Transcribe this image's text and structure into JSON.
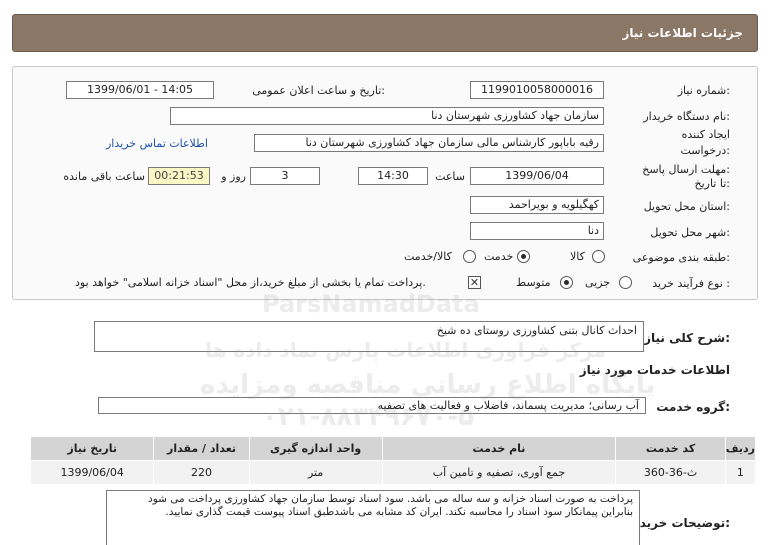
{
  "header": {
    "title": "جزئیات اطلاعات نیاز"
  },
  "form": {
    "need_number_label": "شماره نیاز:",
    "need_number": "1199010058000016",
    "announce_label": "تاریخ و ساعت اعلان عمومی:",
    "announce_value": "1399/06/01 - 14:05",
    "buyer_label": "نام دستگاه خریدار:",
    "buyer_value": "سازمان جهاد کشاورزی شهرستان دنا",
    "creator_label_1": "ایجاد کننده",
    "creator_label_2": "درخواست:",
    "creator_value": "رقیه باباپور کارشناس مالی سازمان جهاد کشاورزی شهرستان دنا",
    "contact_link": "اطلاعات تماس خریدار",
    "deadline_label_1": "مهلت ارسال پاسخ:",
    "deadline_label_2": "تا تاریخ:",
    "deadline_date": "1399/06/04",
    "time_label": "ساعت",
    "deadline_time": "14:30",
    "days_value": "3",
    "days_label": "روز و",
    "remaining_time": "00:21:53",
    "remaining_label": "ساعت باقی مانده",
    "province_label": "استان محل تحویل:",
    "province_value": "کهگیلویه و بویراحمد",
    "city_label": "شهر محل تحویل:",
    "city_value": "دنا",
    "category_label": "طبقه بندی موضوعی:",
    "category_options": [
      "کالا",
      "خدمت",
      "کالا/خدمت"
    ],
    "category_selected": "خدمت",
    "process_label": "نوع فرآیند خرید :",
    "process_options": [
      "جزیی",
      "متوسط"
    ],
    "process_selected": "متوسط",
    "payment_note": "پرداخت تمام یا بخشی از مبلغ خرید،از محل \"اسناد خزانه اسلامی\" خواهد بود."
  },
  "summary": {
    "label": "شرح کلی نیاز:",
    "value": "احداث کانال بتنی کشاورزی روستای ده شیخ"
  },
  "services": {
    "section_title": "اطلاعات خدمات مورد نیاز",
    "group_label": "گروه خدمت:",
    "group_value": "آب رسانی؛ مدیریت پسماند، فاضلاب و فعالیت های تصفیه",
    "columns": [
      "ردیف",
      "کد خدمت",
      "نام خدمت",
      "واحد اندازه گیری",
      "تعداد / مقدار",
      "تاریخ نیاز"
    ],
    "rows": [
      {
        "row": "1",
        "code": "ث-36-360",
        "name": "جمع آوری، تصفیه و تامین آب",
        "unit": "متر",
        "qty": "220",
        "date": "1399/06/04"
      }
    ]
  },
  "notes": {
    "label": "توضیحات خریدار:",
    "text": "پرداخت به صورت اسناد خزانه و سه ساله می باشد. سود اسناد توسط سازمان جهاد کشاورزی پرداخت می شود بنابراین پیمانکار سود اسناد را محاسبه نکند. ایران کد مشابه می باشدطبق اسناد پیوست قیمت گذاری نمایید."
  },
  "watermark": {
    "line1": "ParsNamadData",
    "line2": "مرکز فراوری اطلاعات پارس نماد داده ها",
    "line3": "پایگاه اطلاع رسانی مناقصه ومزایده",
    "line4": "۰۲۱-۸۸۳۴۹۶۷۰-۵"
  }
}
